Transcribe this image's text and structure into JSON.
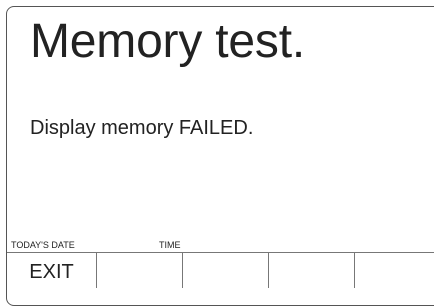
{
  "screen": {
    "title": "Memory test.",
    "message": "Display memory FAILED."
  },
  "status": {
    "date_label": "TODAY'S DATE",
    "time_label": "TIME"
  },
  "softkeys": [
    {
      "label": "EXIT"
    },
    {
      "label": ""
    },
    {
      "label": ""
    },
    {
      "label": ""
    },
    {
      "label": ""
    }
  ]
}
